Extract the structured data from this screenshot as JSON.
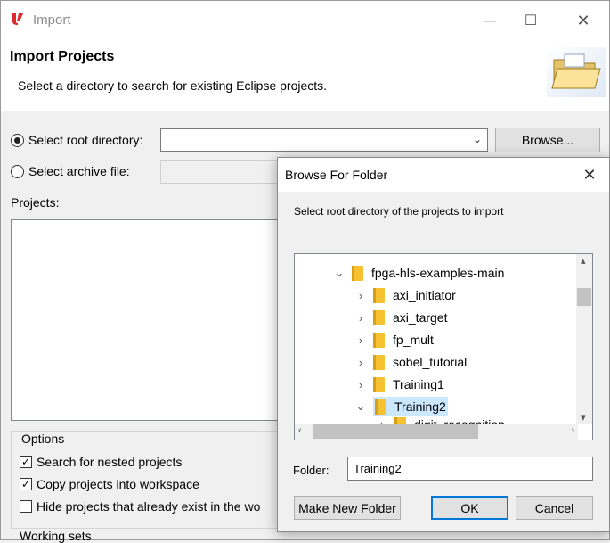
{
  "window": {
    "title": "Import",
    "minimize_glyph": "─",
    "maximize_glyph": "☐",
    "close_glyph": "✕"
  },
  "banner": {
    "title": "Import Projects",
    "description": "Select a directory to search for existing Eclipse projects."
  },
  "source": {
    "root_directory_label": "Select root directory:",
    "root_directory_value": "",
    "root_selected": true,
    "browse_label": "Browse...",
    "archive_file_label": "Select archive file:",
    "archive_selected": false
  },
  "projects": {
    "label": "Projects:",
    "items": []
  },
  "options": {
    "title": "Options",
    "items": [
      {
        "label": "Search for nested projects",
        "checked": true
      },
      {
        "label": "Copy projects into workspace",
        "checked": true
      },
      {
        "label": "Hide projects that already exist in the wo",
        "checked": false
      }
    ]
  },
  "working_sets": {
    "label": "Working sets"
  },
  "browse_dialog": {
    "title": "Browse For Folder",
    "close_glyph": "✕",
    "instruction": "Select root directory of the projects to import",
    "tree": [
      {
        "label": "fpga-hls-examples-main",
        "expanded": true,
        "level": 0,
        "selected": false
      },
      {
        "label": "axi_initiator",
        "expanded": false,
        "level": 1,
        "selected": false
      },
      {
        "label": "axi_target",
        "expanded": false,
        "level": 1,
        "selected": false
      },
      {
        "label": "fp_mult",
        "expanded": false,
        "level": 1,
        "selected": false
      },
      {
        "label": "sobel_tutorial",
        "expanded": false,
        "level": 1,
        "selected": false
      },
      {
        "label": "Training1",
        "expanded": false,
        "level": 1,
        "selected": false
      },
      {
        "label": "Training2",
        "expanded": true,
        "level": 1,
        "selected": true
      },
      {
        "label": "digit_recognition",
        "expanded": false,
        "level": 2,
        "selected": false
      }
    ],
    "folder_label": "Folder:",
    "folder_value": "Training2",
    "make_new_folder_label": "Make New Folder",
    "ok_label": "OK",
    "cancel_label": "Cancel"
  },
  "colors": {
    "selection": "#cce8ff",
    "folder": "#f6c232",
    "accent": "#0078d7"
  }
}
